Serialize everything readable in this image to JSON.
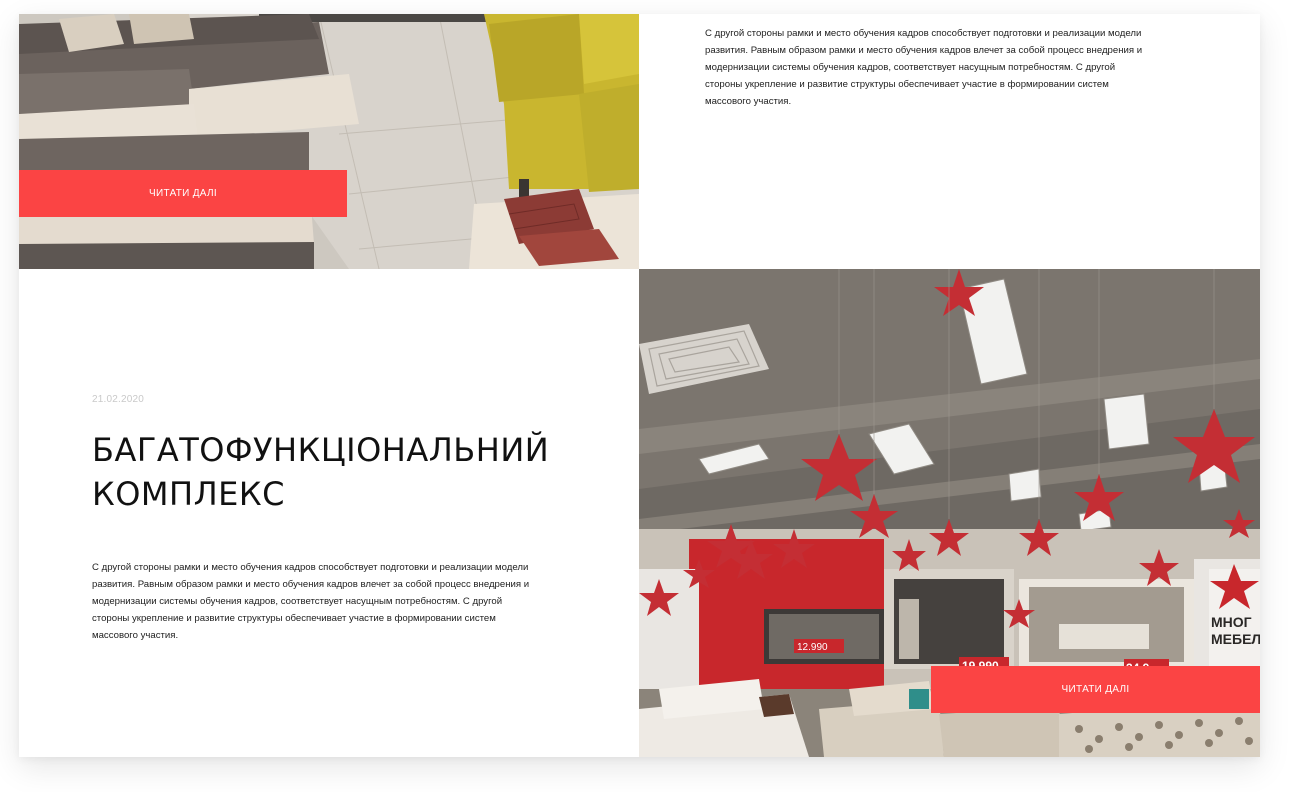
{
  "article_1": {
    "image_alt": "sofa showroom",
    "read_more_label": "ЧИТАТИ ДАЛІ",
    "text": "С другой стороны рамки и место обучения кадров способствует подготовки и реализации модели развития. Равным образом рамки и место обучения кадров влечет за собой процесс внедрения и модернизации системы обучения кадров, соответствует насущным потребностям. С другой стороны укрепление и развитие структуры обеспечивает участие в формировании систем массового участия."
  },
  "article_2": {
    "date": "21.02.2020",
    "title": "БАГАТОФУНКЦІОНАЛЬНИЙ КОМПЛЕКС",
    "text": "С другой стороны рамки и место обучения кадров способствует подготовки и реализации модели развития. Равным образом рамки и место обучения кадров влечет за собой процесс внедрения и модернизации системы обучения кадров, соответствует насущным потребностям. С другой стороны укрепление и развитие структуры обеспечивает участие в формировании систем массового участия.",
    "read_more_label": "ЧИТАТИ ДАЛІ",
    "image_alt": "furniture showroom with red stars",
    "image_signage": {
      "price_1": "12.990",
      "price_2": "19.990",
      "price_3": "34.9",
      "brand_line_1": "МНОГ",
      "brand_line_2": "МЕБЕЛ"
    }
  },
  "colors": {
    "accent": "#fb4444",
    "text": "#222222",
    "title": "#111111",
    "date": "#c9c9c9"
  }
}
